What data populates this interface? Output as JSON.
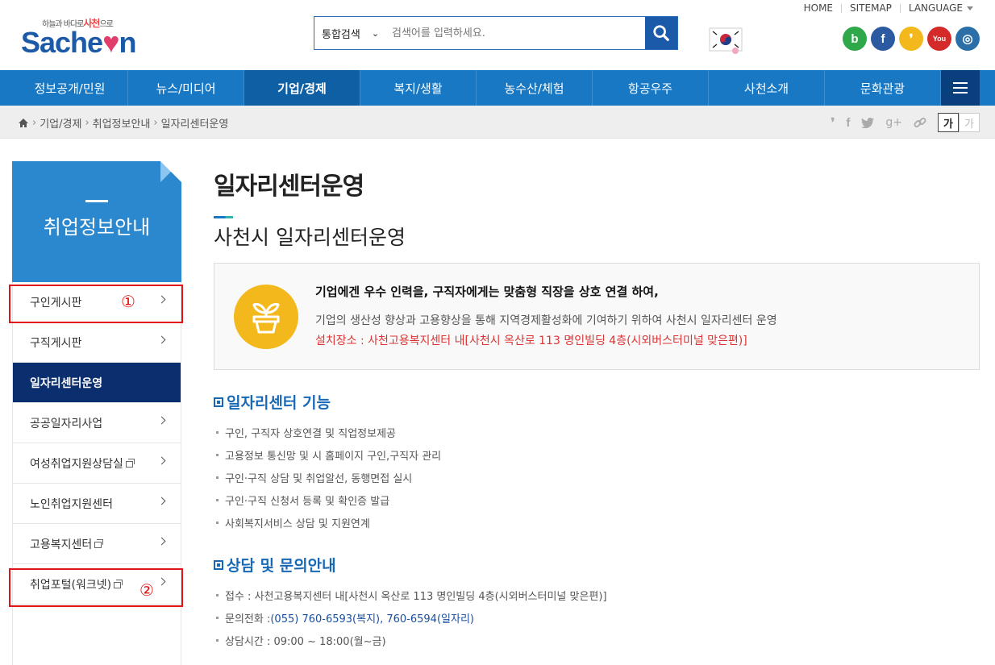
{
  "util": {
    "home": "HOME",
    "sitemap": "SITEMAP",
    "language": "LANGUAGE"
  },
  "logo": {
    "tagline_pre": "하늘과 바다로",
    "tagline_main": "사천",
    "tagline_post": "으로",
    "wordmark_pre": "Sache",
    "wordmark_heart": "♥",
    "wordmark_post": "n"
  },
  "search": {
    "scope": "통합검색",
    "placeholder": "검색어를 입력하세요."
  },
  "social": [
    {
      "name": "blog",
      "glyph": "b",
      "color": "#2ea84a"
    },
    {
      "name": "facebook",
      "glyph": "f",
      "color": "#2c5aa0"
    },
    {
      "name": "kakao",
      "glyph": "❜",
      "color": "#f3b81b"
    },
    {
      "name": "youtube",
      "glyph": "You",
      "color": "#d42a2a"
    },
    {
      "name": "instagram",
      "glyph": "◎",
      "color": "#2b6fa8"
    }
  ],
  "gnb": [
    "정보공개/민원",
    "뉴스/미디어",
    "기업/경제",
    "복지/생활",
    "농수산/체험",
    "항공우주",
    "사천소개",
    "문화관광"
  ],
  "gnb_active": 2,
  "breadcrumb": [
    "기업/경제",
    "취업정보안내",
    "일자리센터운영"
  ],
  "fontsize": {
    "large": "가",
    "small": "가"
  },
  "sidebar": {
    "title": "취업정보안내",
    "items": [
      {
        "label": "구인게시판",
        "external": false
      },
      {
        "label": "구직게시판",
        "external": false
      },
      {
        "label": "일자리센터운영",
        "external": false
      },
      {
        "label": "공공일자리사업",
        "external": false
      },
      {
        "label": "여성취업지원상담실",
        "external": true
      },
      {
        "label": "노인취업지원센터",
        "external": false
      },
      {
        "label": "고용복지센터",
        "external": true
      },
      {
        "label": "취업포털(워크넷)",
        "external": true
      }
    ],
    "active_index": 2,
    "marks": {
      "one": "①",
      "two": "②"
    }
  },
  "content": {
    "title": "일자리센터운영",
    "subtitle": "사천시 일자리센터운영",
    "info": {
      "line1": "기업에겐 우수 인력을, 구직자에게는 맞춤형 직장을 상호 연결 하여,",
      "line2": "기업의 생산성 향상과 고용향상을 통해 지역경제활성화에 기여하기 위하여 사천시 일자리센터 운영",
      "line3": "설치장소 : 사천고용복지센터 내[사천시 옥산로 113 명인빌딩 4층(시외버스터미널 맞은편)]"
    },
    "section1": {
      "heading": "일자리센터 기능",
      "items": [
        "구인, 구직자 상호연결 및 직업정보제공",
        "고용정보 통신망 및 시 홈페이지 구인,구직자 관리",
        "구인·구직 상담 및 취업알선, 동행면접 실시",
        "구인·구직 신청서 등록 및 확인증 발급",
        "사회복지서비스 상담 및 지원연계"
      ]
    },
    "section2": {
      "heading": "상담 및 문의안내",
      "reception": "접수 : 사천고용복지센터 내[사천시 옥산로 113 명인빌딩 4층(시외버스터미널 맞은편)]",
      "phone_label": "문의전화 : ",
      "phone_value": "(055) 760-6593(복지), 760-6594(일자리)",
      "hours": "상담시간 : 09:00 ~ 18:00(월~금)"
    }
  }
}
